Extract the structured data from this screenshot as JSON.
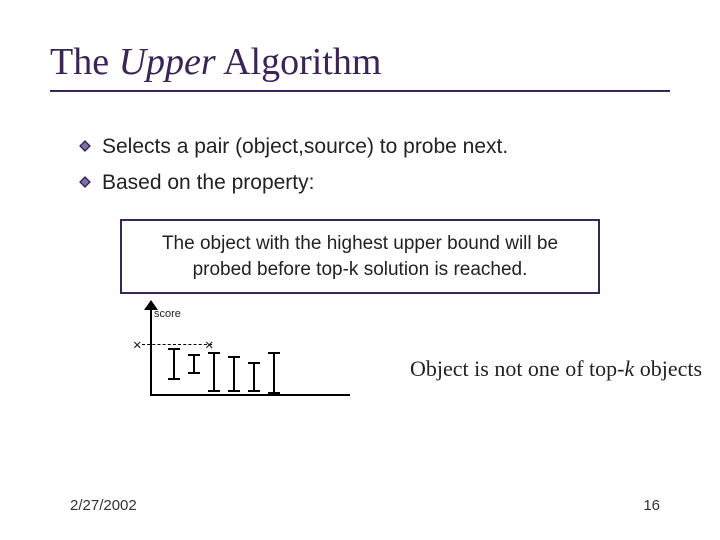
{
  "title": {
    "pre": "The ",
    "emph": "Upper",
    "post": " Algorithm"
  },
  "bullets": [
    "Selects a pair (object,source) to probe next.",
    "Based on the property:"
  ],
  "box_text": "The object with the highest upper bound will be probed before top-k solution is reached.",
  "axis_label": "score",
  "caption": {
    "pre": "Object is not one of top-",
    "k": "k",
    "post": " objects"
  },
  "footer": {
    "date": "2/27/2002",
    "page": "16"
  }
}
